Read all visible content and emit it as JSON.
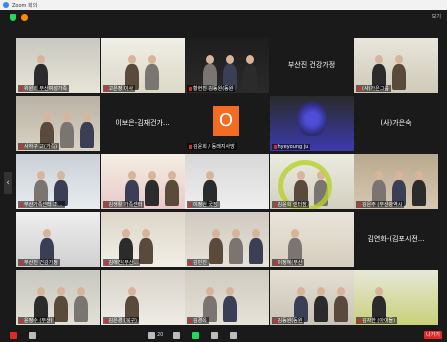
{
  "window": {
    "title": "Zoom 회의"
  },
  "topbar": {
    "view_label": "보기"
  },
  "tiles": [
    {
      "name": "부산여성",
      "label": "위원회 부산여성가족",
      "kind": "video"
    },
    {
      "name": "고은정",
      "label": "고은정 이사",
      "kind": "video"
    },
    {
      "name": "황현진",
      "label": "황현진 김동원(동원",
      "kind": "video"
    },
    {
      "name": "부산진 건강가정",
      "label": "",
      "kind": "name"
    },
    {
      "name": "(사)가은",
      "label": "(사)가은그룹",
      "kind": "video"
    },
    {
      "name": "",
      "label": "사하구 교(가족)",
      "kind": "video"
    },
    {
      "name": "이보은-김재건가...",
      "label": "",
      "kind": "name"
    },
    {
      "name": "김윤희",
      "label": "김윤희 / 동래지사방",
      "kind": "avatar",
      "avatar_letter": "O"
    },
    {
      "name": "hyeyoung ju",
      "label": "hyeyoung ju",
      "kind": "flower"
    },
    {
      "name": "(사)가은숙",
      "label": "",
      "kind": "name"
    },
    {
      "name": "부산가족",
      "label": "부산가족센터 조...",
      "kind": "video"
    },
    {
      "name": "김생활",
      "label": "김생활 가족센터",
      "kind": "video"
    },
    {
      "name": "이정원",
      "label": "이정원 국장",
      "kind": "video"
    },
    {
      "name": "김윤희",
      "label": "김윤희 센터장",
      "kind": "video"
    },
    {
      "name": "김은주",
      "label": "김은주 (부산광역시",
      "kind": "video"
    },
    {
      "name": "부산진건강가정",
      "label": "부산진 건강가정",
      "kind": "video"
    },
    {
      "name": "김애진",
      "label": "김애진(부산...",
      "kind": "video"
    },
    {
      "name": "김민진",
      "label": "김민진",
      "kind": "video"
    },
    {
      "name": "이정혜",
      "label": "이정혜(부산",
      "kind": "video"
    },
    {
      "name": "김연화-(김포시전...",
      "label": "",
      "kind": "name"
    },
    {
      "name": "윤정",
      "label": "윤정수 (부산)",
      "kind": "video"
    },
    {
      "name": "김은경",
      "label": "김은경 (북구)",
      "kind": "video"
    },
    {
      "name": "김경옥",
      "label": "김경옥",
      "kind": "video"
    },
    {
      "name": "김동원",
      "label": "김동원(동원",
      "kind": "video"
    },
    {
      "name": "김자한",
      "label": "김자한 (아이들)",
      "kind": "video"
    }
  ],
  "toolbar": {
    "items": [
      "음소거",
      "비디오 중지",
      "참가자 20",
      "채팅",
      "화면 공유",
      "기록",
      "반응"
    ],
    "participants_count": "20",
    "end_label": "나가기"
  },
  "colors": {
    "accent": "#2d8cff",
    "end": "#e02828",
    "mute": "#e02828"
  }
}
